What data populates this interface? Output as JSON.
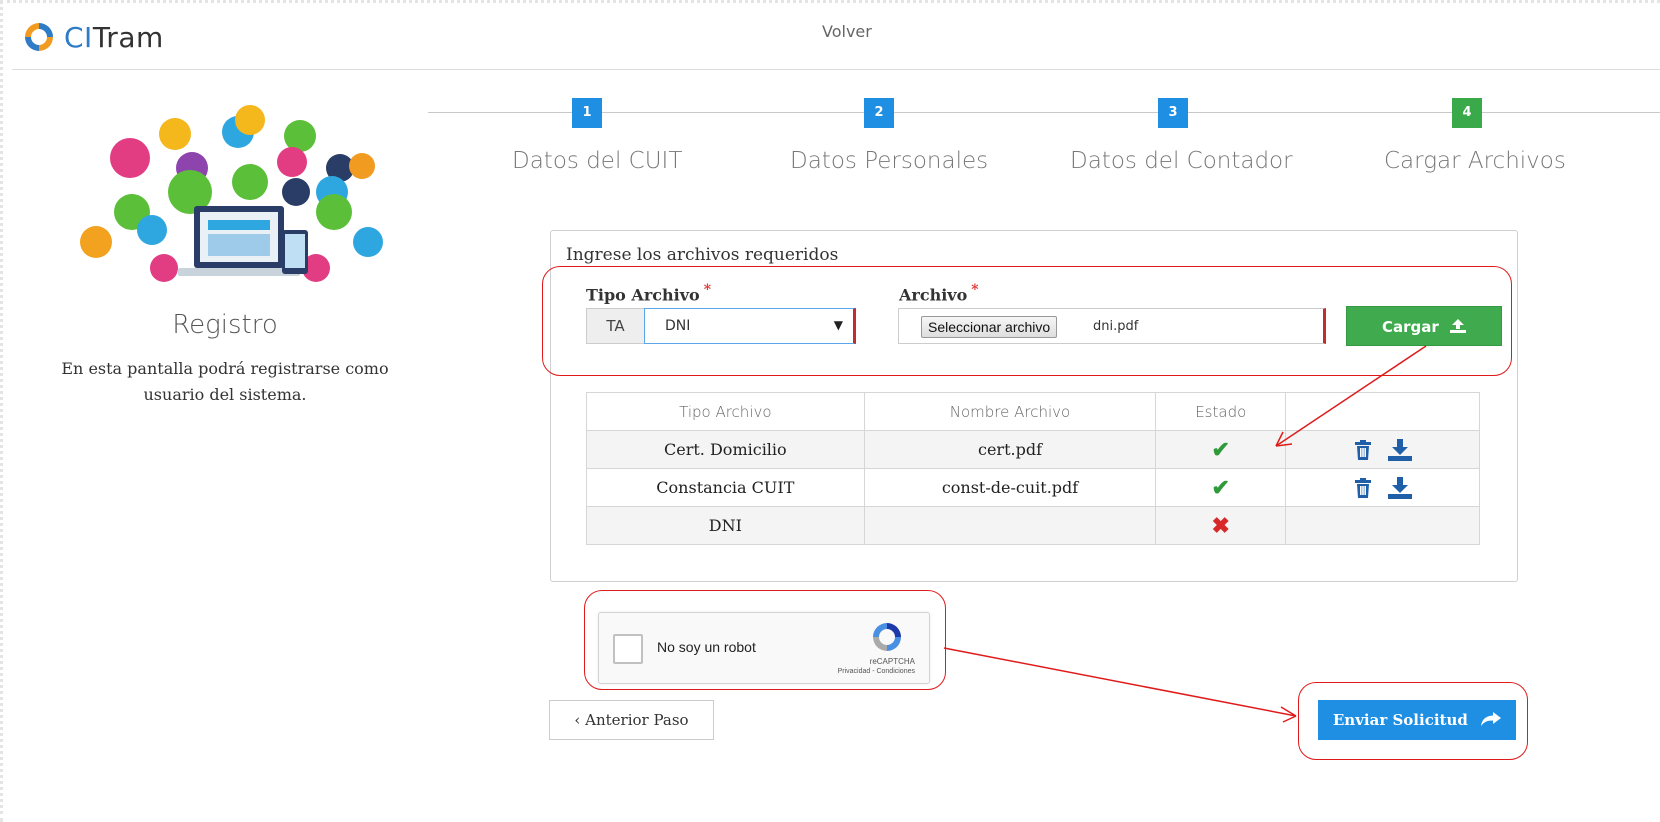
{
  "header": {
    "brand_prefix": "CI",
    "brand_suffix": "Tram",
    "back_link": "Volver"
  },
  "sidebar": {
    "illustration": "registration-illustration",
    "title": "Registro",
    "description": "En esta pantalla podrá registrarse como usuario del sistema."
  },
  "stepper": {
    "steps": [
      {
        "number": "1",
        "label": "Datos del CUIT",
        "state": "active"
      },
      {
        "number": "2",
        "label": "Datos Personales",
        "state": "active"
      },
      {
        "number": "3",
        "label": "Datos del Contador",
        "state": "active"
      },
      {
        "number": "4",
        "label": "Cargar Archivos",
        "state": "done"
      }
    ]
  },
  "form": {
    "section_title": "Ingrese los archivos requeridos",
    "tipo_label": "Tipo Archivo",
    "archivo_label": "Archivo",
    "required_mark": "*",
    "tipo_addon": "TA",
    "tipo_value": "DNI",
    "file_button": "Seleccionar archivo",
    "file_name": "dni.pdf",
    "upload_button": "Cargar",
    "upload_icon": "upload-icon"
  },
  "table": {
    "headers": [
      "Tipo Archivo",
      "Nombre Archivo",
      "Estado",
      ""
    ],
    "rows": [
      {
        "tipo": "Cert. Domicilio",
        "nombre": "cert.pdf",
        "estado": "ok",
        "actions": [
          "trash-icon",
          "download-icon"
        ]
      },
      {
        "tipo": "Constancia CUIT",
        "nombre": "const-de-cuit.pdf",
        "estado": "ok",
        "actions": [
          "trash-icon",
          "download-icon"
        ]
      },
      {
        "tipo": "DNI",
        "nombre": "",
        "estado": "missing",
        "actions": []
      }
    ],
    "ok_glyph": "✔",
    "missing_glyph": "✖"
  },
  "captcha": {
    "label": "No soy un robot",
    "brand": "reCAPTCHA",
    "links": "Privacidad - Condiciones"
  },
  "buttons": {
    "prev_label": "‹ Anterior Paso",
    "send_label": "Enviar Solicitud",
    "send_icon": "share-arrow-icon"
  },
  "colors": {
    "primary": "#1f8fe4",
    "success": "#3faa4e",
    "danger": "#d82828",
    "annotation": "#e01a1a"
  }
}
